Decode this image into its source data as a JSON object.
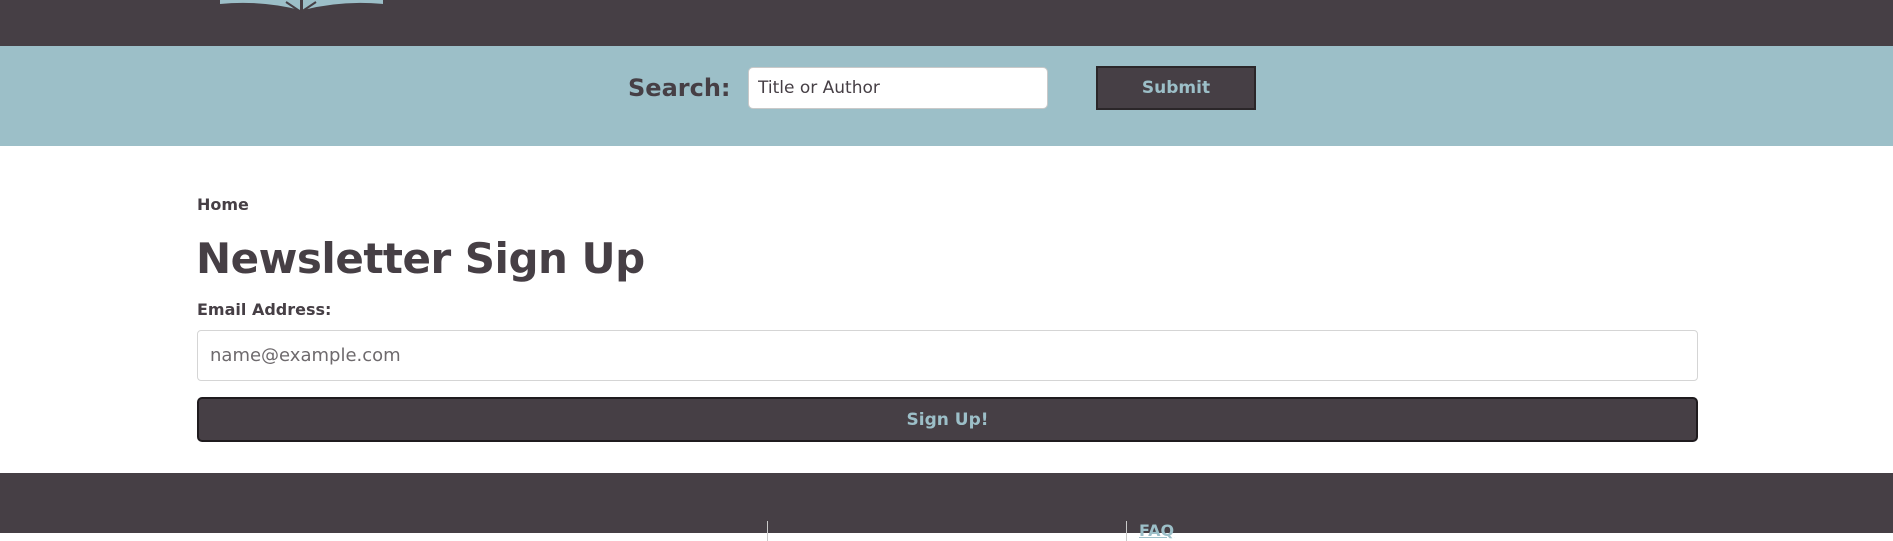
{
  "header": {
    "logo_icon": "open-book-icon",
    "colors": {
      "dark": "#463f45",
      "accent": "#9cbfc8"
    }
  },
  "search": {
    "label": "Search:",
    "placeholder": "Title or Author",
    "submit_label": "Submit"
  },
  "breadcrumb": {
    "home": "Home"
  },
  "main": {
    "title": "Newsletter Sign Up",
    "email_label": "Email Address:",
    "email_placeholder": "name@example.com",
    "signup_label": "Sign Up!"
  },
  "footer": {
    "links": [
      "FAQ"
    ]
  }
}
